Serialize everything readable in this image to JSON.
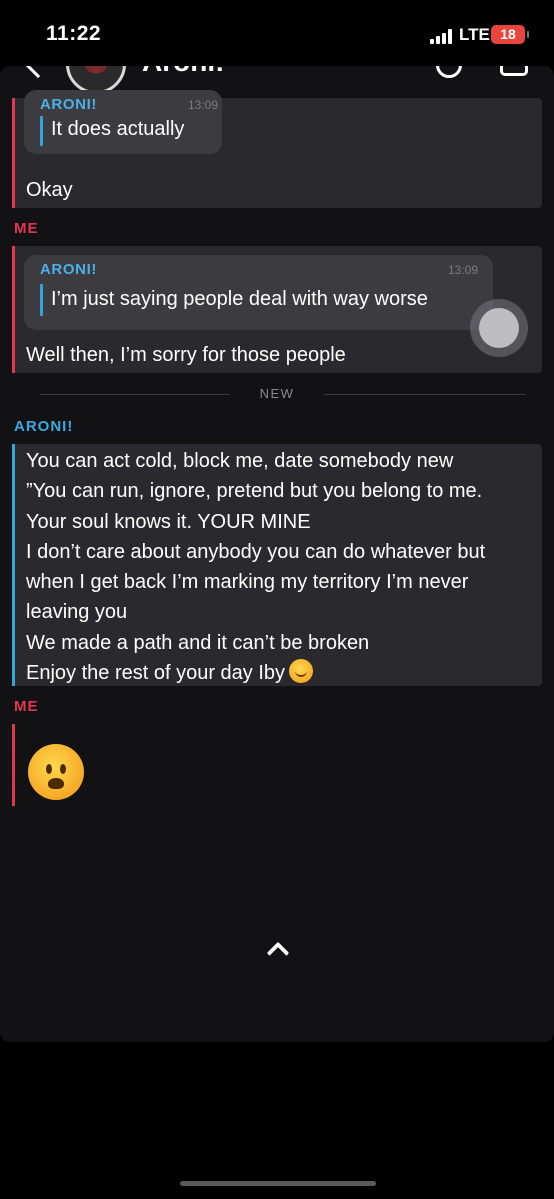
{
  "status_bar": {
    "time": "11:22",
    "network": "LTE",
    "battery": "18"
  },
  "header": {
    "contact_name": "Aroni!"
  },
  "colors": {
    "me": "#e5344f",
    "them": "#2fa6de",
    "bubble": "#2a2a2e",
    "quote": "#3b3b40"
  },
  "messages": [
    {
      "quote_sender": "ARONI!",
      "quote_time": "13:09",
      "quote_text": "It does actually",
      "text": "Okay"
    },
    {
      "sender": "ME",
      "quote_sender": "ARONI!",
      "quote_time": "13:09",
      "quote_text": "I’m just saying people deal with way worse",
      "text": "Well then, I’m sorry for those people"
    }
  ],
  "divider": {
    "label": "NEW"
  },
  "aroni_block": {
    "sender": "ARONI!",
    "lines": [
      "You can act cold, block me, date somebody new",
      "”You can run, ignore, pretend but you belong to me.",
      "Your soul knows it. YOUR MINE",
      "I don’t care about anybody you can do whatever but",
      "when I get back I’m marking my territory I’m never",
      "leaving you",
      "We made a path and it can’t be broken",
      "Enjoy the rest of your day Iby"
    ],
    "last_line_emoji": "smiling-face-icon"
  },
  "last_me": {
    "sender": "ME",
    "emoji": "frowning-face-icon"
  },
  "icons": {
    "back": "back-icon",
    "call": "call-icon",
    "video": "video-icon",
    "scroll": "chevron-up-icon"
  }
}
